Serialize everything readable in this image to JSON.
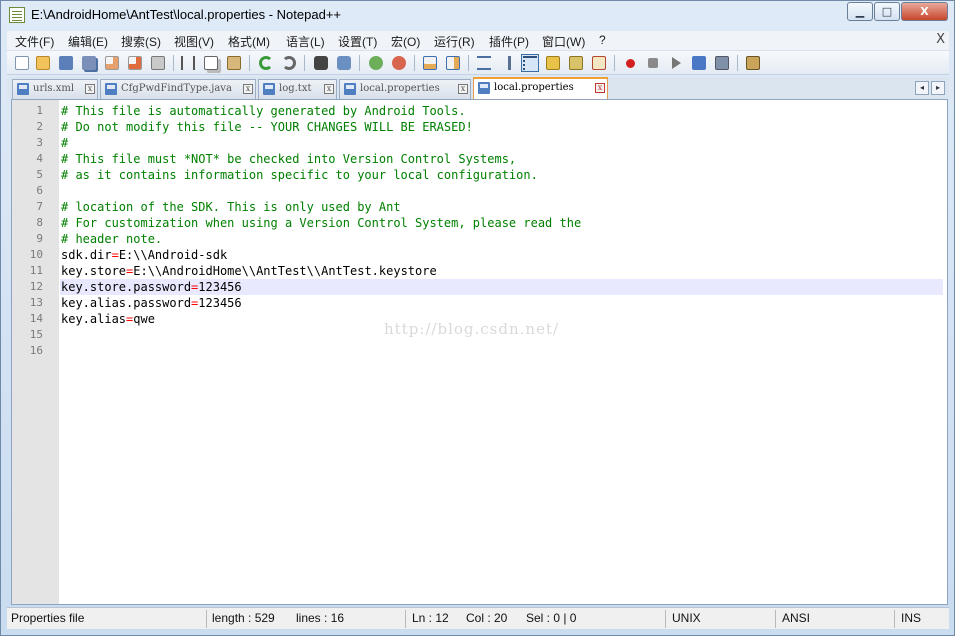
{
  "window": {
    "title": "E:\\AndroidHome\\AntTest\\local.properties - Notepad++",
    "minimize": "▁",
    "maximize": "□",
    "close": "X"
  },
  "menu": {
    "items": [
      "文件(F)",
      "编辑(E)",
      "搜索(S)",
      "视图(V)",
      "格式(M)",
      "语言(L)",
      "设置(T)",
      "宏(O)",
      "运行(R)",
      "插件(P)",
      "窗口(W)",
      "?"
    ],
    "close_label": "X"
  },
  "toolbar": {
    "icons": [
      "new-file-icon",
      "open-file-icon",
      "save-icon",
      "save-all-icon",
      "close-icon",
      "close-all-icon",
      "print-icon",
      "cut-icon",
      "copy-icon",
      "paste-icon",
      "undo-icon",
      "redo-icon",
      "find-icon",
      "replace-icon",
      "zoom-in-icon",
      "zoom-out-icon",
      "sync-v-icon",
      "sync-h-icon",
      "word-wrap-icon",
      "show-all-chars-icon",
      "indent-guide-icon",
      "udl-icon",
      "doc-map-icon",
      "function-list-icon",
      "record-macro-icon",
      "stop-macro-icon",
      "play-macro-icon",
      "run-macro-multiple-icon",
      "save-macro-icon",
      "spell-check-icon"
    ]
  },
  "tabs": [
    {
      "label": "urls.xml",
      "active": false
    },
    {
      "label": "CfgPwdFindType.java",
      "active": false
    },
    {
      "label": "log.txt",
      "active": false
    },
    {
      "label": "local.properties",
      "active": false
    },
    {
      "label": "local.properties",
      "active": true
    }
  ],
  "tab_close_glyph": "x",
  "tab_nav": {
    "prev": "◂",
    "next": "▸"
  },
  "editor": {
    "lines": [
      {
        "num": "1",
        "text": "# This file is automatically generated by Android Tools.",
        "kind": "comment"
      },
      {
        "num": "2",
        "text": "# Do not modify this file -- YOUR CHANGES WILL BE ERASED!",
        "kind": "comment"
      },
      {
        "num": "3",
        "text": "#",
        "kind": "comment"
      },
      {
        "num": "4",
        "text": "# This file must *NOT* be checked into Version Control Systems,",
        "kind": "comment"
      },
      {
        "num": "5",
        "text": "# as it contains information specific to your local configuration.",
        "kind": "comment"
      },
      {
        "num": "6",
        "text": "",
        "kind": "blank"
      },
      {
        "num": "7",
        "text": "# location of the SDK. This is only used by Ant",
        "kind": "comment"
      },
      {
        "num": "8",
        "text": "# For customization when using a Version Control System, please read the",
        "kind": "comment"
      },
      {
        "num": "9",
        "text": "# header note.",
        "kind": "comment"
      },
      {
        "num": "10",
        "key": "sdk.dir",
        "value": "E:\\\\Android-sdk",
        "kind": "prop"
      },
      {
        "num": "11",
        "key": "key.store",
        "value": "E:\\\\AndroidHome\\\\AntTest\\\\AntTest.keystore",
        "kind": "prop"
      },
      {
        "num": "12",
        "key": "key.store.password",
        "value": "123456",
        "kind": "prop",
        "current": true
      },
      {
        "num": "13",
        "key": "key.alias.password",
        "value": "123456",
        "kind": "prop"
      },
      {
        "num": "14",
        "key": "key.alias",
        "value": "qwe",
        "kind": "prop"
      },
      {
        "num": "15",
        "text": "",
        "kind": "blank"
      },
      {
        "num": "16",
        "text": "",
        "kind": "blank"
      }
    ],
    "watermark": "http://blog.csdn.net/"
  },
  "status": {
    "file_type": "Properties file",
    "length": "length : 529",
    "lines": "lines : 16",
    "ln": "Ln : 12",
    "col": "Col : 20",
    "sel": "Sel : 0 | 0",
    "eol": "UNIX",
    "encoding": "ANSI",
    "mode": "INS"
  },
  "colors": {
    "comment": "#008000",
    "operator": "#ff0000",
    "current_line": "#e8e8ff",
    "gutter": "#e4e4e4"
  }
}
